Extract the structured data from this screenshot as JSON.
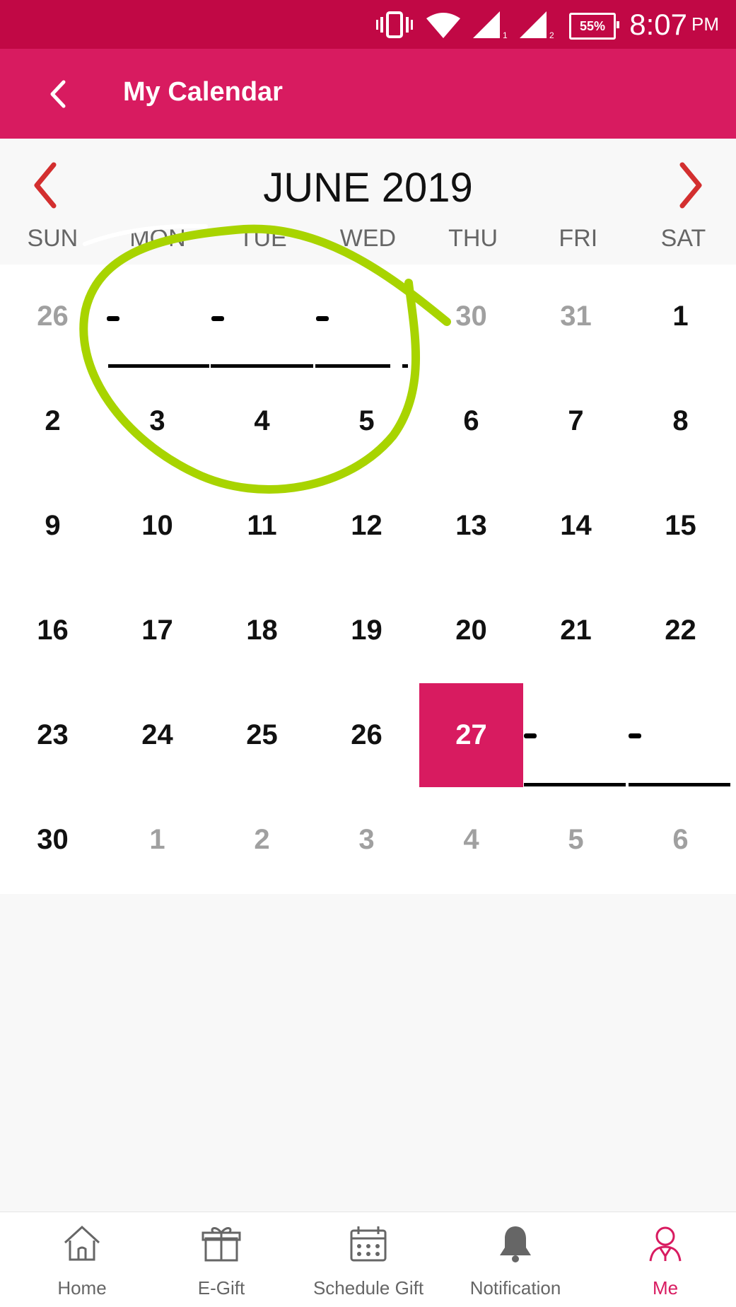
{
  "status": {
    "battery": "55%",
    "time": "8:07",
    "ampm": "PM"
  },
  "app": {
    "title": "My Calendar"
  },
  "calendar": {
    "month_title": "JUNE 2019",
    "weekdays": [
      "SUN",
      "MON",
      "TUE",
      "WED",
      "THU",
      "FRI",
      "SAT"
    ],
    "rows": [
      [
        "26",
        "",
        "",
        "",
        "30",
        "31",
        "1"
      ],
      [
        "2",
        "3",
        "4",
        "5",
        "6",
        "7",
        "8"
      ],
      [
        "9",
        "10",
        "11",
        "12",
        "13",
        "14",
        "15"
      ],
      [
        "16",
        "17",
        "18",
        "19",
        "20",
        "21",
        "22"
      ],
      [
        "23",
        "24",
        "25",
        "26",
        "27",
        "",
        ""
      ],
      [
        "30",
        "1",
        "2",
        "3",
        "4",
        "5",
        "6"
      ]
    ],
    "selected_day": "27"
  },
  "bottom_nav": {
    "home": "Home",
    "egift": "E-Gift",
    "schedule": "Schedule Gift",
    "notification": "Notification",
    "me": "Me"
  },
  "colors": {
    "primary": "#d81b60",
    "status": "#c10845",
    "accent_annotation": "#a8d400"
  }
}
